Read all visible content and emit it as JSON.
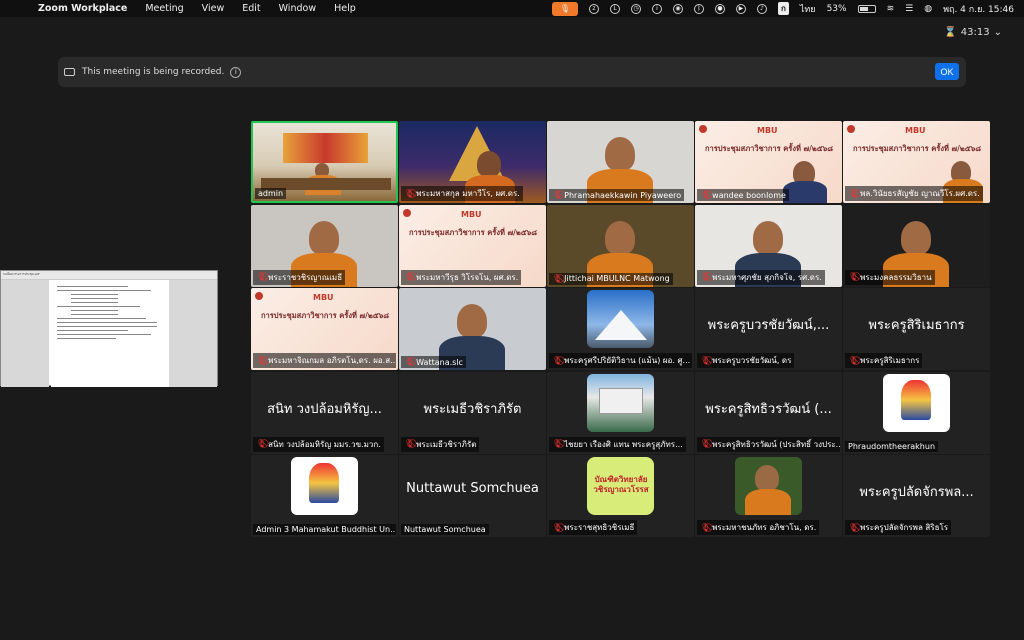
{
  "menubar": {
    "app_name": "Zoom Workplace",
    "menus": [
      "Meeting",
      "View",
      "Edit",
      "Window",
      "Help"
    ],
    "input_source": "ไทย",
    "battery": "53%",
    "datetime": "พฤ. 4 ก.ย.  15:46"
  },
  "meeting": {
    "timer": "43:13",
    "recording_notice": "This meeting is being recorded.",
    "ok_label": "OK"
  },
  "participants": [
    {
      "label": "admin",
      "muted": false,
      "active": true,
      "kind": "video-room"
    },
    {
      "label": "พระมหาสกุล มหาวีโร, ผศ.ดร.",
      "muted": true,
      "kind": "video-temple"
    },
    {
      "label": "Phramahaekkawin Piyaweero",
      "muted": true,
      "kind": "video-monk"
    },
    {
      "label": "wandee boonlome",
      "muted": true,
      "kind": "slide-woman"
    },
    {
      "label": "พล.วินัยธรสัญชัย ญาณวีโร.ผศ.ดร.",
      "muted": true,
      "kind": "slide-monk"
    },
    {
      "label": "พระราชวชิรญาณเมธี",
      "muted": true,
      "kind": "video-monk2"
    },
    {
      "label": "พระมหาวีรุธ วิโรจโน, ผศ.ดร.",
      "muted": true,
      "kind": "slide"
    },
    {
      "label": "Jittichai MBULNC Matwong",
      "muted": true,
      "kind": "video-monk3"
    },
    {
      "label": "พระมหาศุภชัย สุภกิจโจ, รศ.ดร.",
      "muted": true,
      "kind": "video-man"
    },
    {
      "label": "พระมงคลธรรมวิธาน",
      "muted": true,
      "kind": "video-monk4"
    },
    {
      "label": "พระมหาจิณกมล อภิรตโน,ดร. ผอ.ส...",
      "muted": true,
      "kind": "slide"
    },
    {
      "label": "Wattana.slc",
      "muted": true,
      "kind": "video-man2"
    },
    {
      "label": "พระครูศรีปริยัติวิธาน (แม้น) ผอ. ศู...",
      "muted": true,
      "kind": "photo-mountain"
    },
    {
      "label": "พระครูบวรชัยวัฒน์, ดร",
      "muted": true,
      "kind": "name",
      "big_name": "พระครูบวรชัยวัฒน์,..."
    },
    {
      "label": "พระครูสิริเมธากร",
      "muted": true,
      "kind": "name",
      "big_name": "พระครูสิริเมธากร"
    },
    {
      "label": "สนิท  วงปล้อมหิรัญ มมร.วข.มวก.",
      "muted": true,
      "kind": "name",
      "big_name": "สนิท  วงปล้อมหิรัญ..."
    },
    {
      "label": "พระเมธีวชิราภิรัต",
      "muted": true,
      "kind": "name",
      "big_name": "พระเมธีวชิราภิรัต"
    },
    {
      "label": "ไชยยา  เรืองศิ  แทน  พระครูสุภัทร...",
      "muted": true,
      "kind": "photo-building"
    },
    {
      "label": "พระครูสิทธิวรวัฒน์ (ประสิทธิ์ วงประ...",
      "muted": true,
      "kind": "name",
      "big_name": "พระครูสิทธิวรวัฒน์ (..."
    },
    {
      "label": "Phraudomtheerakhun",
      "muted": false,
      "kind": "photo-emblem"
    },
    {
      "label": "Admin 3 Mahamakut Buddhist Un...",
      "muted": false,
      "kind": "photo-emblem"
    },
    {
      "label": "Nuttawut Somchuea",
      "muted": false,
      "kind": "name",
      "big_name": "Nuttawut Somchuea"
    },
    {
      "label": "พระราชสุทธิวชิรเมธี",
      "muted": true,
      "kind": "photo-badge"
    },
    {
      "label": "พระมหาชนภัทร อภิชาโน, ดร.",
      "muted": true,
      "kind": "photo-monk"
    },
    {
      "label": "พระครูปลัดจักรพล สิริธโร",
      "muted": true,
      "kind": "name",
      "big_name": "พระครูปลัดจักรพล..."
    }
  ],
  "slide_text": {
    "mbu": "MBU",
    "title": "การประชุมสภาวิชาการ ครั้งที่ ๗/๒๕๖๘"
  },
  "badge_text": "บัณฑิตวิทยาลัย วชิรญาณวโรรส",
  "doc_window": {
    "title": "ระเบียบวาระการประชุม.pdf"
  },
  "colors": {
    "accent": "#0e71eb",
    "active_speaker": "#23c552",
    "muted": "#e33333",
    "mic_indicator": "#f07a2a"
  }
}
